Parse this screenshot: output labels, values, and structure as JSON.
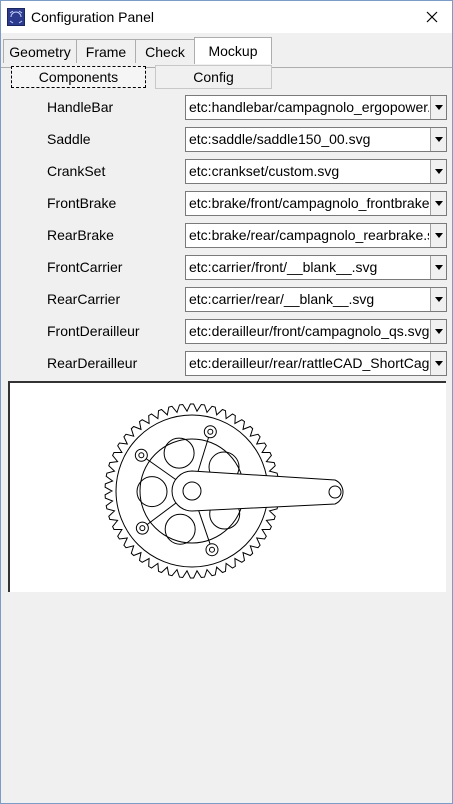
{
  "window": {
    "title": "Configuration Panel"
  },
  "tabs": [
    {
      "label": "Geometry",
      "active": false
    },
    {
      "label": "Frame",
      "active": false
    },
    {
      "label": "Check",
      "active": false
    },
    {
      "label": "Mockup",
      "active": true
    }
  ],
  "subtabs": [
    {
      "label": "Components",
      "active": true
    },
    {
      "label": "Config",
      "active": false
    }
  ],
  "components": [
    {
      "label": "HandleBar",
      "value": "etc:handlebar/campagnolo_ergopower.svg"
    },
    {
      "label": "Saddle",
      "value": "etc:saddle/saddle150_00.svg"
    },
    {
      "label": "CrankSet",
      "value": "etc:crankset/custom.svg"
    },
    {
      "label": "FrontBrake",
      "value": "etc:brake/front/campagnolo_frontbrake.svg"
    },
    {
      "label": "RearBrake",
      "value": "etc:brake/rear/campagnolo_rearbrake.svg"
    },
    {
      "label": "FrontCarrier",
      "value": "etc:carrier/front/__blank__.svg"
    },
    {
      "label": "RearCarrier",
      "value": "etc:carrier/rear/__blank__.svg"
    },
    {
      "label": "FrontDerailleur",
      "value": "etc:derailleur/front/campagnolo_qs.svg"
    },
    {
      "label": "RearDerailleur",
      "value": "etc:derailleur/rear/rattleCAD_ShortCage.svg"
    }
  ],
  "preview": {
    "icon": "crankset-drawing"
  },
  "colors": {
    "titlebar_bg": "#ffffff",
    "window_bg": "#f0f0f0",
    "border": "#7a9cc6"
  }
}
